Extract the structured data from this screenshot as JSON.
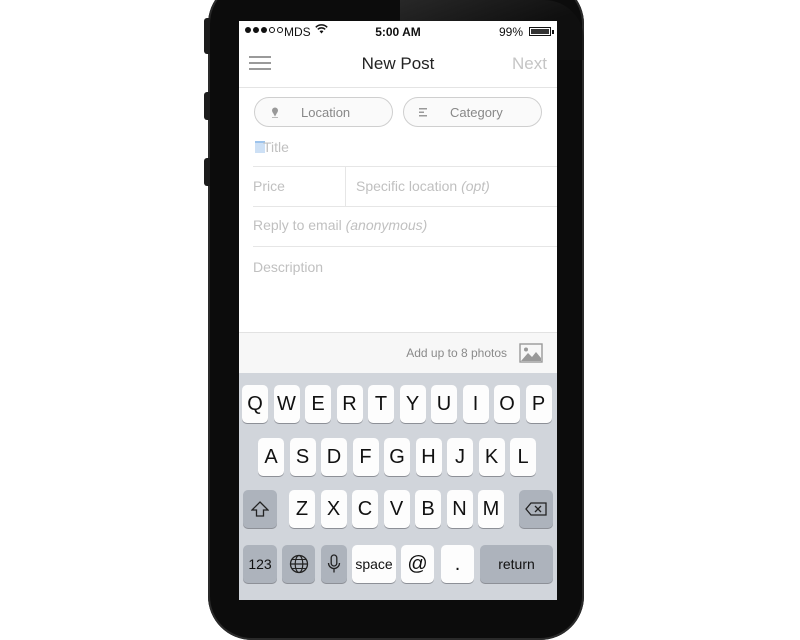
{
  "status_bar": {
    "carrier": "MDS",
    "time": "5:00 AM",
    "battery": "99%",
    "signal_strength": 3,
    "signal_max": 5
  },
  "nav": {
    "title": "New Post",
    "next_label": "Next"
  },
  "form": {
    "location_label": "Location",
    "category_label": "Category",
    "title_placeholder": "Title",
    "price_placeholder": "Price",
    "specific_location_placeholder": "Specific location",
    "specific_location_opt": "(opt)",
    "reply_email_placeholder": "Reply to email",
    "reply_email_anon": "(anonymous)",
    "description_placeholder": "Description"
  },
  "photos": {
    "label": "Add up to 8 photos"
  },
  "keyboard": {
    "row1": [
      "Q",
      "W",
      "E",
      "R",
      "T",
      "Y",
      "U",
      "I",
      "O",
      "P"
    ],
    "row2": [
      "A",
      "S",
      "D",
      "F",
      "G",
      "H",
      "J",
      "K",
      "L"
    ],
    "row3": [
      "Z",
      "X",
      "C",
      "V",
      "B",
      "N",
      "M"
    ],
    "numbers_label": "123",
    "space_label": "space",
    "at_label": "@",
    "period_label": ".",
    "return_label": "return"
  },
  "colors": {
    "placeholder": "#c0c0c0",
    "next_disabled": "#c5c5c5",
    "keyboard_bg": "#d1d5db"
  },
  "icons": [
    "menu-icon",
    "wifi-icon",
    "battery-icon",
    "location-pin-icon",
    "category-list-icon",
    "photo-icon",
    "shift-icon",
    "backspace-icon",
    "globe-icon",
    "microphone-icon"
  ]
}
